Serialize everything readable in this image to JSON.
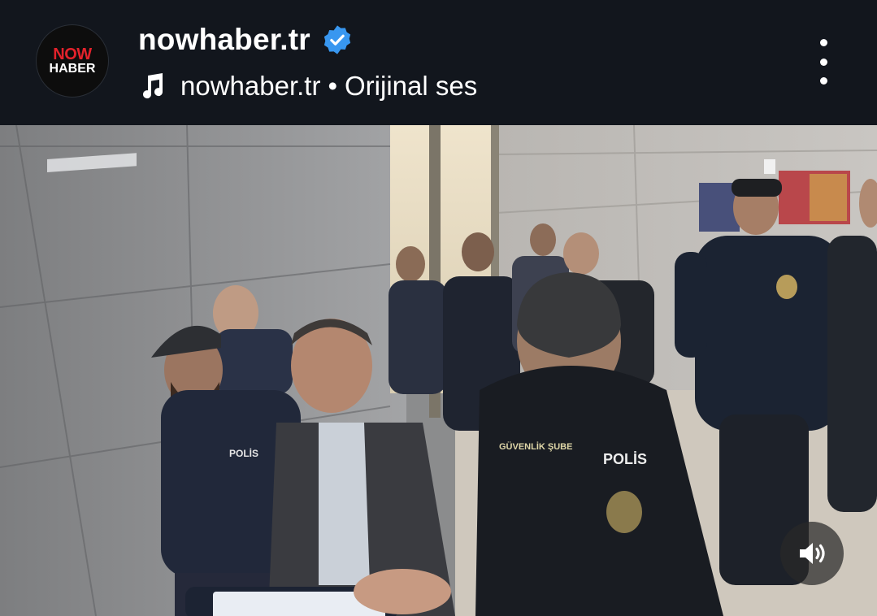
{
  "post": {
    "account_name": "nowhaber.tr",
    "avatar": {
      "line1": "NOW",
      "line2": "HABER"
    },
    "verified_icon": "verified-badge-icon",
    "audio": {
      "icon": "music-note-icon",
      "artist": "nowhaber.tr",
      "separator": "•",
      "track": "Orijinal ses"
    },
    "menu_icon": "more-vertical-icon"
  },
  "video": {
    "scene_text": {
      "vest_left": "POLİS",
      "vest_right_badge": "GÜVENLİK ŞUBE",
      "vest_right": "POLİS"
    },
    "sound_icon": "volume-icon"
  },
  "colors": {
    "header_bg": "#12161d",
    "verified_blue": "#3897f0",
    "brand_red": "#e3222b"
  }
}
